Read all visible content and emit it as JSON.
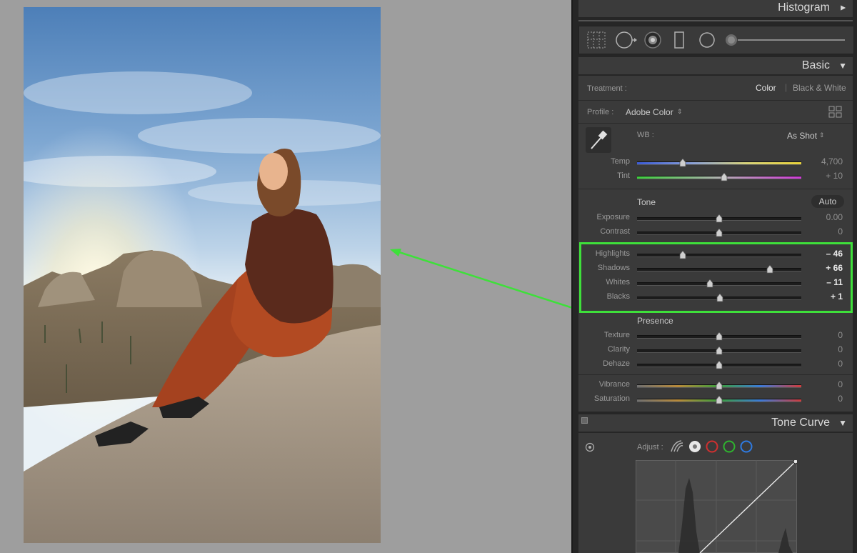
{
  "colors": {
    "accent": "#3ee03a",
    "panel": "#3a3a3a",
    "arrow": "#3ee03a"
  },
  "panel": {
    "histogram_title": "Histogram",
    "basic_title": "Basic",
    "tone_curve_title": "Tone Curve",
    "toolstrip_icons": [
      "crop-grid-icon",
      "spot-removal-icon",
      "red-eye-icon",
      "graduated-filter-icon",
      "radial-filter-icon",
      "brush-slider-icon"
    ],
    "treatment": {
      "label": "Treatment :",
      "options": [
        "Color",
        "Black & White"
      ],
      "selected": "Color"
    },
    "profile": {
      "label": "Profile :",
      "value": "Adobe Color",
      "arrows": "⌃⌄"
    },
    "wb": {
      "label": "WB :",
      "value": "As Shot",
      "arrows": "⌃⌄"
    },
    "wb_sliders": [
      {
        "label": "Temp",
        "value": "4,700",
        "position": 0.28,
        "gradient": "temp"
      },
      {
        "label": "Tint",
        "value": "+ 10",
        "position": 0.53,
        "gradient": "tint"
      }
    ],
    "tone": {
      "title": "Tone",
      "auto_label": "Auto"
    },
    "tone_sliders": [
      {
        "label": "Exposure",
        "value": "0.00",
        "position": 0.5
      },
      {
        "label": "Contrast",
        "value": "0",
        "position": 0.5
      }
    ],
    "highlight_sliders": [
      {
        "label": "Highlights",
        "value": "– 46",
        "position": 0.28
      },
      {
        "label": "Shadows",
        "value": "+ 66",
        "position": 0.81
      },
      {
        "label": "Whites",
        "value": "– 11",
        "position": 0.445
      },
      {
        "label": "Blacks",
        "value": "+ 1",
        "position": 0.505
      }
    ],
    "presence": {
      "title": "Presence"
    },
    "presence_sliders": [
      {
        "label": "Texture",
        "value": "0",
        "position": 0.5
      },
      {
        "label": "Clarity",
        "value": "0",
        "position": 0.5
      },
      {
        "label": "Dehaze",
        "value": "0",
        "position": 0.5
      }
    ],
    "color_sliders": [
      {
        "label": "Vibrance",
        "value": "0",
        "position": 0.5,
        "gradient": "vib"
      },
      {
        "label": "Saturation",
        "value": "0",
        "position": 0.5,
        "gradient": "sat"
      }
    ],
    "tone_curve": {
      "adjust_label": "Adjust :"
    }
  }
}
